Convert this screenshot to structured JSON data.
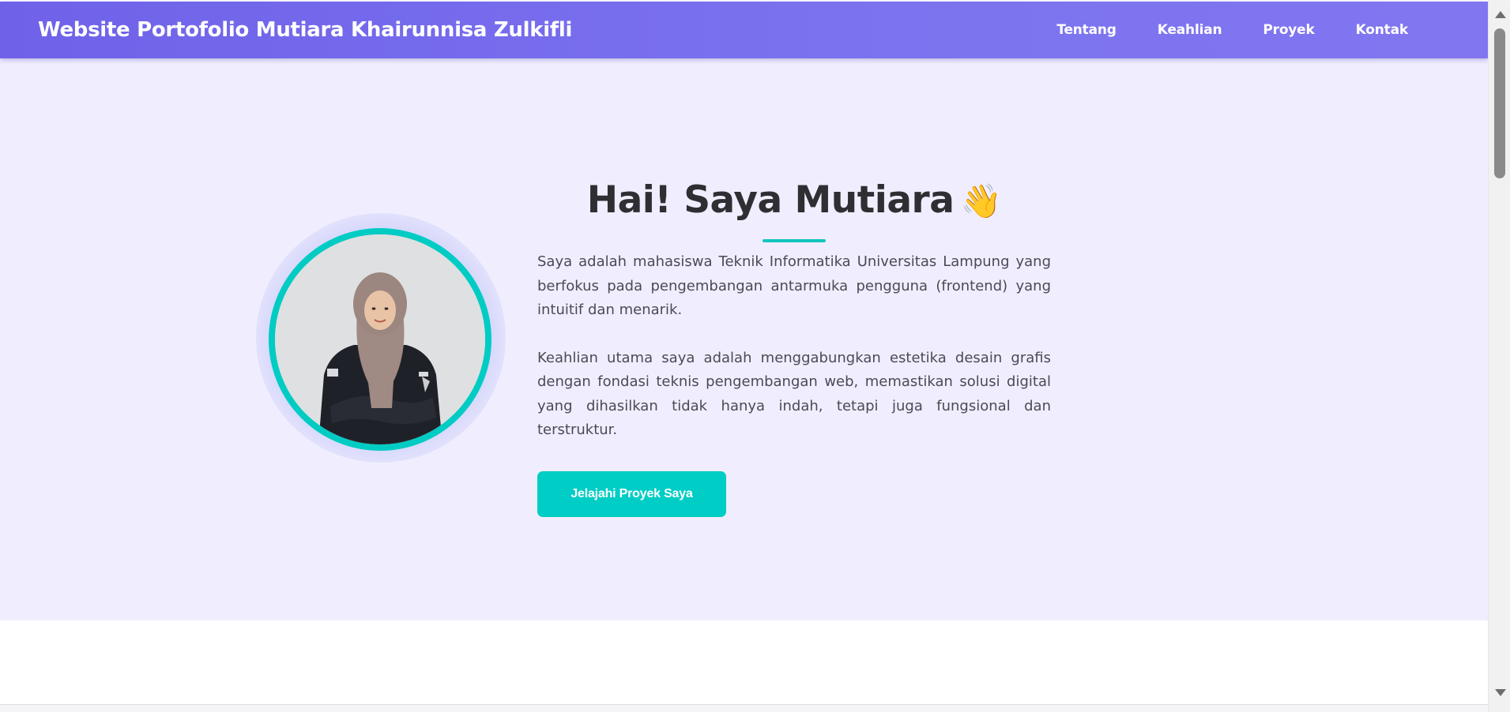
{
  "header": {
    "brand": "Website Portofolio Mutiara Khairunnisa Zulkifli",
    "nav": [
      "Tentang",
      "Keahlian",
      "Proyek",
      "Kontak"
    ]
  },
  "hero": {
    "title": "Hai! Saya Mutiara",
    "wave": "👋",
    "paragraphs": [
      "Saya adalah mahasiswa Teknik Informatika Universitas Lampung yang berfokus pada pengembangan antarmuka pengguna (frontend) yang intuitif dan menarik.",
      "Keahlian utama saya adalah menggabungkan estetika desain grafis dengan fondasi teknis pengembangan web, memastikan solusi digital yang dihasilkan tidak hanya indah, tetapi juga fungsional dan terstruktur."
    ],
    "cta_label": "Jelajahi Proyek Saya"
  },
  "colors": {
    "header_start": "#6f62e9",
    "header_end": "#8276f0",
    "hero_bg": "#f0eefe",
    "accent": "#00cdc5",
    "heading_text": "#2f2f33",
    "body_text": "#4a4a55"
  },
  "icons": {
    "wave": "waving-hand-icon",
    "scroll_up": "scroll-up-arrow-icon",
    "scroll_down": "scroll-down-arrow-icon"
  }
}
